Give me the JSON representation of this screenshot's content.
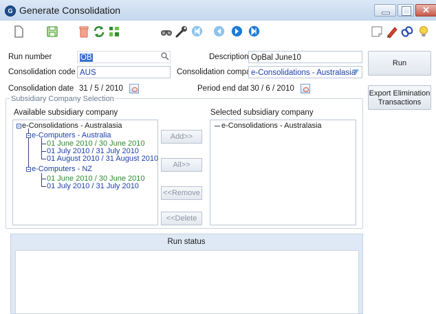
{
  "window": {
    "title": "Generate Consolidation",
    "logo_letter": "G"
  },
  "toolbar": {
    "left_icons": [
      "new-icon",
      "save-icon",
      "delete-icon",
      "refresh-icon",
      "layout-icon"
    ],
    "nav_icons": [
      "binoculars-icon",
      "tool-icon",
      "first-icon",
      "previous-icon",
      "next-icon",
      "last-icon"
    ],
    "right_icons": [
      "note-icon",
      "pencil-icon",
      "link-icon",
      "lightbulb-icon"
    ]
  },
  "form": {
    "run_number_label": "Run number",
    "run_number_value": "OB",
    "description_label": "Description",
    "description_value": "OpBal June10",
    "consolidation_code_label": "Consolidation code",
    "consolidation_code_value": "AUS",
    "consolidation_company_label": "Consolidation company",
    "consolidation_company_value": "e-Consolidations - Australasia",
    "consolidation_date_label": "Consolidation date",
    "consolidation_date_value": "31 / 5 / 2010",
    "period_end_date_label": "Period end date",
    "period_end_date_value": "30 / 6 / 2010"
  },
  "side_buttons": {
    "run_label": "Run",
    "export_line1": "Export Elimination",
    "export_line2": "Transactions"
  },
  "selection": {
    "group_title": "Subsidiary Company Selection",
    "available_label": "Available subsidiary company",
    "selected_label": "Selected subsidiary company",
    "tree": {
      "root": "e-Consolidations - Australasia",
      "child1": "e-Computers - Australia",
      "child1_periods": [
        "01 June 2010 / 30 June 2010",
        "01 July 2010 / 31 July 2010",
        "01 August 2010 / 31 August 2010"
      ],
      "child2": "e-Computers - NZ",
      "child2_periods": [
        "01 June 2010 / 30 June 2010",
        "01 July 2010 / 31 July 2010"
      ]
    },
    "selected_items": [
      "e-Consolidations - Australasia"
    ],
    "buttons": {
      "add": "Add>>",
      "all": "All>>",
      "remove": "<<Remove",
      "delete": "<<Delete"
    }
  },
  "status": {
    "header": "Run status"
  }
}
